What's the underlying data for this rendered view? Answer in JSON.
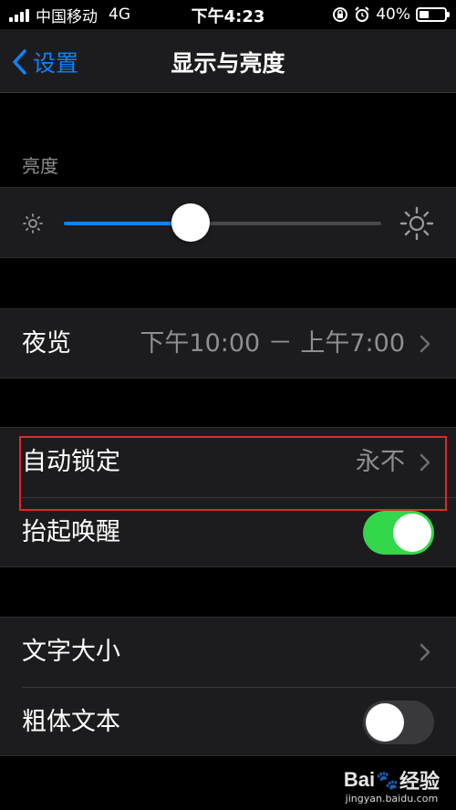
{
  "status_bar": {
    "carrier": "中国移动",
    "network": "4G",
    "time": "下午4:23",
    "battery_percent": "40%",
    "battery_level": 0.4,
    "icons": [
      "signal-icon",
      "rotation-lock-icon",
      "alarm-icon",
      "battery-icon"
    ]
  },
  "nav": {
    "back_label": "设置",
    "title": "显示与亮度"
  },
  "brightness": {
    "header": "亮度",
    "level": 0.4,
    "icons": [
      "sun-small-icon",
      "sun-large-icon"
    ]
  },
  "night_shift": {
    "label": "夜览",
    "value": "下午10:00 － 上午7:00"
  },
  "auto_lock": {
    "label": "自动锁定",
    "value": "永不"
  },
  "raise_to_wake": {
    "label": "抬起唤醒",
    "enabled": true
  },
  "text_size": {
    "label": "文字大小"
  },
  "bold_text": {
    "label": "粗体文本",
    "enabled": false
  },
  "colors": {
    "accent": "#0a84ff",
    "toggle_on": "#32d74b",
    "highlight": "#e0262b"
  },
  "watermark": {
    "logo_left": "Bai",
    "logo_right": "经验",
    "url": "jingyan.baidu.com"
  }
}
